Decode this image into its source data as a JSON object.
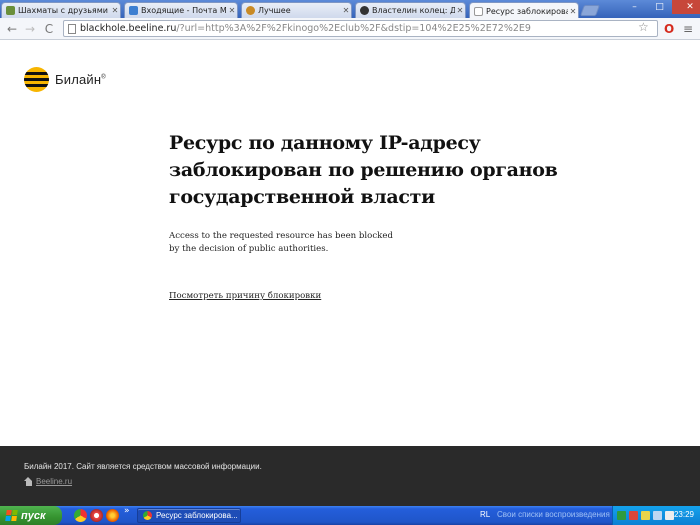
{
  "browser": {
    "tabs": [
      {
        "title": "Шахматы с друзьями",
        "favicon_color": "#6a8f3a"
      },
      {
        "title": "Входящие - Почта Ma",
        "favicon_color": "#3d7fd1"
      },
      {
        "title": "Лучшее",
        "favicon_color": "#c98a25"
      },
      {
        "title": "Властелин колец: Две",
        "favicon_color": "#333333"
      },
      {
        "title": "Ресурс заблокирован",
        "favicon_color": "#ffffff",
        "active": true
      }
    ],
    "window_controls": {
      "minimize": "–",
      "maximize": "□",
      "close": "✕"
    },
    "nav": {
      "back": "←",
      "forward": "→",
      "reload": "C"
    },
    "url": {
      "host": "blackhole.beeline.ru",
      "path": "/?url=http%3A%2F%2Fkinogo%2Eclub%2F&dstip=104%2E25%2E72%2E9"
    },
    "star_icon": "☆",
    "extension_icon": "O",
    "menu_icon": "≡"
  },
  "page": {
    "logo": {
      "text": "Билайн",
      "trademark": "®",
      "brand_color": "#f7b500"
    },
    "headline": [
      "Ресурс по данному IP-адресу",
      "заблокирован по решению органов",
      "государственной власти"
    ],
    "english": [
      "Access to the requested resource has been blocked",
      "by the decision of public authorities."
    ],
    "reason_link": "Посмотреть причину блокировки"
  },
  "footer": {
    "copyright": "Билайн 2017. Сайт является средством массовой информации.",
    "home_link": "Beeline.ru"
  },
  "taskbar": {
    "start_label": "пуск",
    "active_task": "Ресурс заблокирова...",
    "overflow": "»",
    "language": "RL",
    "playlist_hint": "Свои списки воспроизведения",
    "clock": "23:29"
  }
}
